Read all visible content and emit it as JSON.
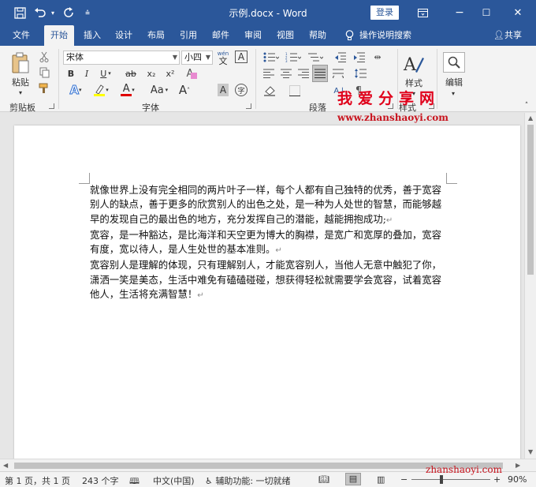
{
  "titlebar": {
    "title": "示例.docx - Word",
    "login_label": "登录",
    "qat_more": "⩮",
    "ribbon_display_icon": "ribbon-display-options-icon",
    "minimize": "−",
    "maximize": "☐",
    "close": "✕"
  },
  "tabs": {
    "file": "文件",
    "home": "开始",
    "insert": "插入",
    "design": "设计",
    "layout": "布局",
    "references": "引用",
    "mailings": "邮件",
    "review": "审阅",
    "view": "视图",
    "help": "帮助",
    "tell_me": "操作说明搜索",
    "share": "共享"
  },
  "ribbon": {
    "clipboard": {
      "paste_label": "粘贴",
      "group_label": "剪贴板"
    },
    "font": {
      "font_name": "宋体",
      "font_size": "小四",
      "wen_top": "wén",
      "wen_bottom": "文",
      "bold": "B",
      "italic": "I",
      "underline": "U",
      "strike": "ab",
      "subscript": "x₂",
      "superscript": "x²",
      "text_effects": "A",
      "highlight": "ab",
      "font_color": "A",
      "case": "Aa",
      "grow": "A",
      "shrink": "A",
      "clear_format": "A",
      "char_shading": "A",
      "char_border": "A",
      "enclosed": "字",
      "group_label": "字体"
    },
    "paragraph": {
      "group_label": "段落"
    },
    "styles": {
      "styles_label": "样式",
      "group_label": "样式"
    },
    "editing": {
      "editing_label": "编辑"
    },
    "watermark_cn": "我爱分享网",
    "watermark_url": "www.zhanshaoyi.com"
  },
  "document": {
    "paragraphs": [
      "就像世界上没有完全相同的两片叶子一样，每个人都有自己独特的优秀，善于宽容别人的缺点，善于更多的欣赏别人的出色之处，是一种为人处世的智慧，而能够越早的发现自己的最出色的地方，充分发挥自己的潜能，越能拥抱成功;",
      "宽容，是一种豁达，是比海洋和天空更为博大的胸襟，是宽广和宽厚的叠加，宽容有度，宽以待人，是人生处世的基本准则。",
      "宽容别人是理解的体现，只有理解别人，才能宽容别人，当他人无意中触犯了你，潇洒一笑是美态，生活中难免有磕磕碰碰，想获得轻松就需要学会宽容，试着宽容他人，生活将充满智慧！"
    ],
    "pilcrow": "↵"
  },
  "status": {
    "page": "第 1 页，共 1 页",
    "words": "243 个字",
    "language": "中文(中国)",
    "accessibility": "辅助功能: 一切就绪",
    "zoom": "90%",
    "watermark": "zhanshaoyi.com"
  }
}
